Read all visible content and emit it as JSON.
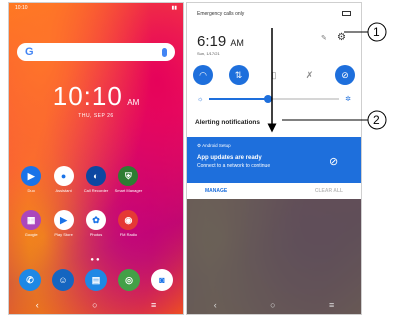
{
  "phone1": {
    "status_time": "10:10",
    "clock": {
      "time": "10:10",
      "ampm": "AM",
      "date": "THU, SEP 26"
    },
    "apps_row1": [
      {
        "label": "Duo",
        "icon": "video-icon",
        "color": "#1a73e8",
        "glyph": "▶"
      },
      {
        "label": "Assistant",
        "icon": "assistant-icon",
        "color": "#ffffff",
        "glyph": "●"
      },
      {
        "label": "Call Recorder",
        "icon": "call-recorder-icon",
        "color": "#0d47a1",
        "glyph": "◐"
      },
      {
        "label": "Smart Manager",
        "icon": "smart-manager-icon",
        "color": "#2e7d32",
        "glyph": "⛨"
      }
    ],
    "apps_row2": [
      {
        "label": "Google",
        "icon": "google-folder-icon",
        "color": "#ab47bc",
        "glyph": "▦"
      },
      {
        "label": "Play Store",
        "icon": "play-store-icon",
        "color": "#ffffff",
        "glyph": "▶"
      },
      {
        "label": "Photos",
        "icon": "photos-icon",
        "color": "#ffffff",
        "glyph": "✿"
      },
      {
        "label": "FM Radio",
        "icon": "fm-radio-icon",
        "color": "#e53935",
        "glyph": "◉"
      }
    ],
    "dock": [
      {
        "icon": "phone-icon",
        "color": "#1e88e5",
        "glyph": "✆"
      },
      {
        "icon": "contacts-icon",
        "color": "#1565c0",
        "glyph": "☺"
      },
      {
        "icon": "messages-icon",
        "color": "#1e88e5",
        "glyph": "▤"
      },
      {
        "icon": "chrome-icon",
        "color": "#43a047",
        "glyph": "◎"
      },
      {
        "icon": "camera-icon",
        "color": "#ffffff",
        "glyph": "◙"
      }
    ]
  },
  "phone2": {
    "emergency": "Emergency calls only",
    "time": "6:19",
    "ampm": "AM",
    "date": "Sun, 1/17/21",
    "tiles": [
      {
        "icon": "wifi-icon",
        "glyph": "◠",
        "on": true
      },
      {
        "icon": "data-icon",
        "glyph": "⇅",
        "on": true
      },
      {
        "icon": "flashlight-icon",
        "glyph": "▯",
        "on": false
      },
      {
        "icon": "bluetooth-off-icon",
        "glyph": "✗",
        "on": false
      },
      {
        "icon": "dnd-icon",
        "glyph": "⊘",
        "on": true
      }
    ],
    "brightness": 0.45,
    "alerting_label": "Alerting notifications",
    "notification": {
      "app": "Android Setup",
      "title": "App updates are ready",
      "text": "Connect to a network to continue"
    },
    "manage_label": "MANAGE",
    "clear_all_label": "CLEAR ALL"
  },
  "callouts": {
    "one": "1",
    "two": "2"
  },
  "colors": {
    "accent": "#1e6fdc"
  }
}
